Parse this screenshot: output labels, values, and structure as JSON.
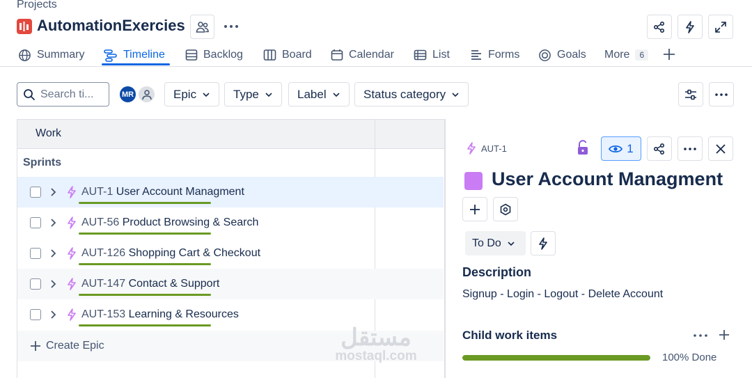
{
  "header": {
    "breadcrumb": "Projects",
    "project_title": "AutomationExercies"
  },
  "tabs": [
    {
      "label": "Summary"
    },
    {
      "label": "Timeline"
    },
    {
      "label": "Backlog"
    },
    {
      "label": "Board"
    },
    {
      "label": "Calendar"
    },
    {
      "label": "List"
    },
    {
      "label": "Forms"
    },
    {
      "label": "Goals"
    },
    {
      "label": "More",
      "badge": "6"
    }
  ],
  "toolbar": {
    "search_placeholder": "Search ti...",
    "avatar_initials": "MR",
    "filters": [
      "Epic",
      "Type",
      "Label",
      "Status category"
    ]
  },
  "timeline": {
    "column_header": "Work",
    "section_label": "Sprints",
    "rows": [
      {
        "key": "AUT-1",
        "title": "User Account Managment"
      },
      {
        "key": "AUT-56",
        "title": "Product Browsing & Search"
      },
      {
        "key": "AUT-126",
        "title": "Shopping Cart & Checkout"
      },
      {
        "key": "AUT-147",
        "title": "Contact & Support"
      },
      {
        "key": "AUT-153",
        "title": "Learning & Resources"
      }
    ],
    "create_label": "Create Epic"
  },
  "detail": {
    "issue_key": "AUT-1",
    "watch_count": "1",
    "title": "User Account Managment",
    "status": "To Do",
    "description_heading": "Description",
    "description": "Signup - Login - Logout - Delete Account",
    "child_heading": "Child work items",
    "progress_fraction": 1.0,
    "progress_label": "100% Done"
  },
  "watermark": {
    "arabic": "مستقل",
    "latin": "mostaql.com"
  },
  "colors": {
    "accent": "#0c66e4",
    "epic": "#c97cf4",
    "progress": "#6a9a23",
    "project_icon": "#e2483d"
  }
}
